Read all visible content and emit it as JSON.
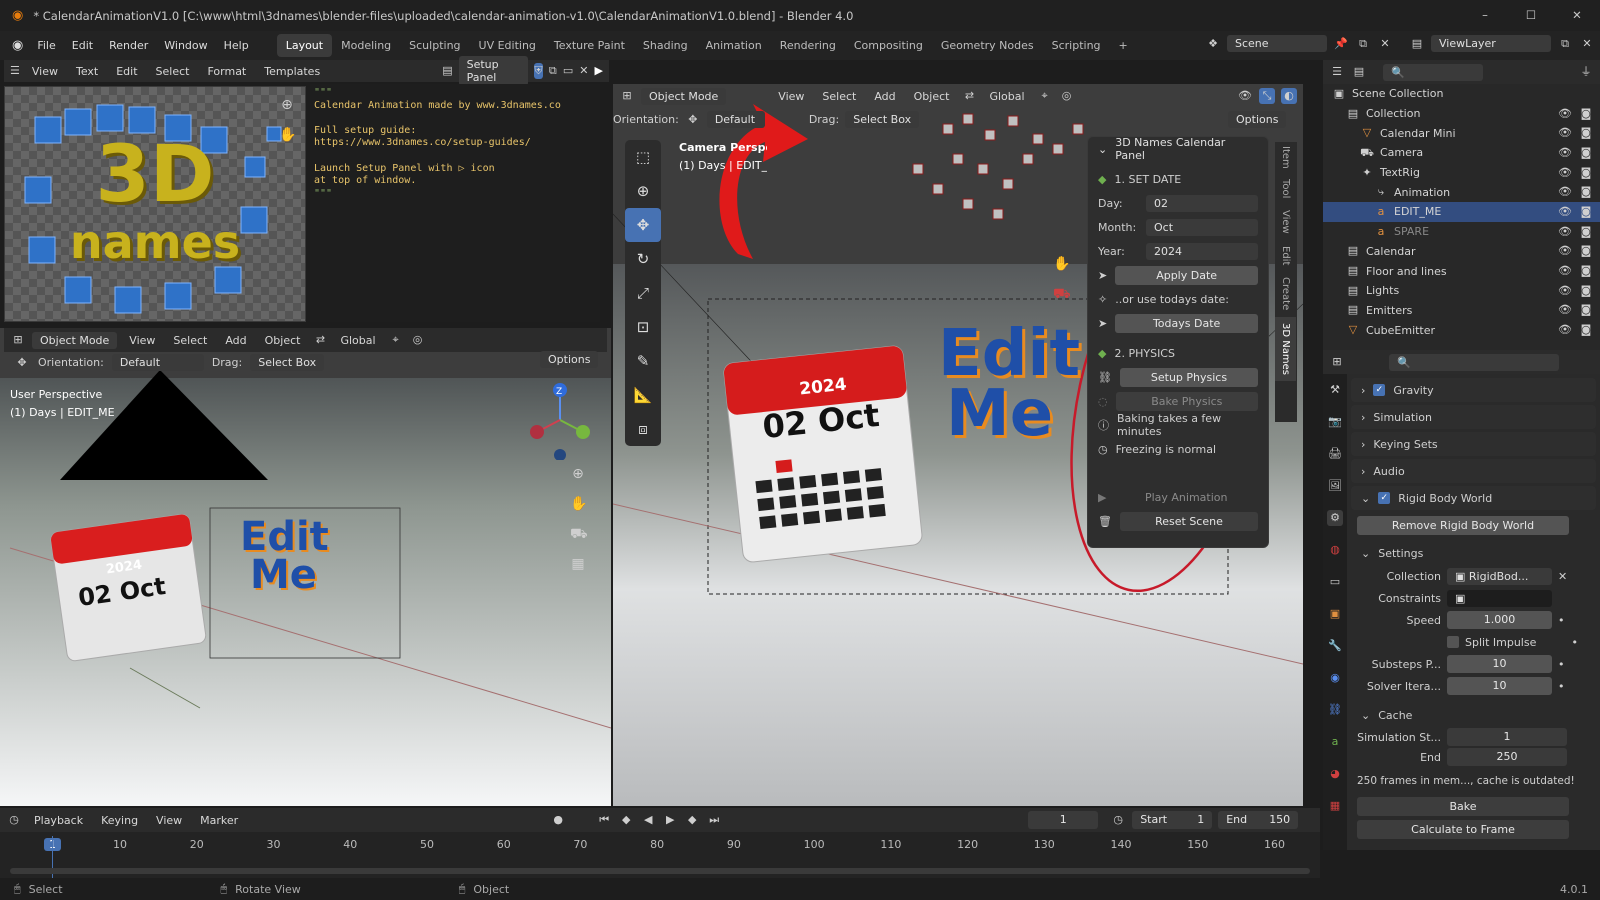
{
  "window": {
    "title": "* CalendarAnimationV1.0 [C:\\www\\html\\3dnames\\blender-files\\uploaded\\calendar-animation-v1.0\\CalendarAnimationV1.0.blend] - Blender 4.0",
    "min": "–",
    "max": "☐",
    "close": "✕"
  },
  "menu": [
    "File",
    "Edit",
    "Render",
    "Window",
    "Help"
  ],
  "workspaces": [
    "Layout",
    "Modeling",
    "Sculpting",
    "UV Editing",
    "Texture Paint",
    "Shading",
    "Animation",
    "Rendering",
    "Compositing",
    "Geometry Nodes",
    "Scripting"
  ],
  "workspace_add": "+",
  "scene": {
    "label": "Scene",
    "viewlayer": "ViewLayer"
  },
  "text_editor": {
    "menus": [
      "View",
      "Text",
      "Edit",
      "Select",
      "Format",
      "Templates"
    ],
    "file": "Setup Panel",
    "lines": [
      "\"\"\"",
      "Calendar Animation made by www.3dnames.co",
      "",
      "Full setup guide:",
      "https://www.3dnames.co/setup-guides/",
      "",
      "Launch Setup Panel with ▷ icon",
      "at top of window.",
      "\"\"\""
    ]
  },
  "logo": {
    "line1": "3D",
    "line2": "names"
  },
  "viewport_left": {
    "mode": "Object Mode",
    "menus": [
      "View",
      "Select",
      "Add",
      "Object"
    ],
    "transform": "Global",
    "orientation_label": "Orientation:",
    "orientation": "Default",
    "drag_label": "Drag:",
    "drag": "Select Box",
    "options": "Options",
    "persp": "User Perspective",
    "context": "(1) Days | EDIT_ME"
  },
  "viewport_main": {
    "mode": "Object Mode",
    "menus": [
      "View",
      "Select",
      "Add",
      "Object"
    ],
    "transform": "Global",
    "orientation_label": "Orientation:",
    "orientation": "Default",
    "drag_label": "Drag:",
    "drag": "Select Box",
    "options": "Options",
    "persp": "Camera Perspective",
    "context": "(1) Days | EDIT_ME",
    "side_tabs": [
      "Item",
      "Tool",
      "View",
      "Edit",
      "Create",
      "3D Names"
    ]
  },
  "calendar": {
    "year": "2024",
    "date": "02 Oct"
  },
  "edit_me": {
    "line1": "Edit",
    "line2": "Me"
  },
  "names_panel": {
    "title": "3D Names Calendar Panel",
    "section1": "1. SET DATE",
    "day_label": "Day:",
    "day": "02",
    "month_label": "Month:",
    "month": "Oct",
    "year_label": "Year:",
    "year": "2024",
    "apply": "Apply Date",
    "or_today": "..or use todays date:",
    "today": "Todays Date",
    "section2": "2. PHYSICS",
    "setup_physics": "Setup Physics",
    "bake_physics": "Bake Physics",
    "note1": "Baking takes a few minutes",
    "note2": "Freezing is normal",
    "play": "Play Animation",
    "reset": "Reset Scene"
  },
  "outliner": {
    "root": "Scene Collection",
    "items": [
      {
        "name": "Collection",
        "indent": 1,
        "icon": "collection-icon"
      },
      {
        "name": "Calendar Mini",
        "indent": 2,
        "icon": "mesh-icon"
      },
      {
        "name": "Camera",
        "indent": 2,
        "icon": "camera-icon"
      },
      {
        "name": "TextRig",
        "indent": 2,
        "icon": "armature-icon"
      },
      {
        "name": "Animation",
        "indent": 3,
        "icon": "action-icon"
      },
      {
        "name": "EDIT_ME",
        "indent": 3,
        "icon": "text-icon"
      },
      {
        "name": "SPARE",
        "indent": 3,
        "icon": "text-icon"
      },
      {
        "name": "Calendar",
        "indent": 1,
        "icon": "collection-icon"
      },
      {
        "name": "Floor and lines",
        "indent": 1,
        "icon": "collection-icon"
      },
      {
        "name": "Lights",
        "indent": 1,
        "icon": "collection-icon"
      },
      {
        "name": "Emitters",
        "indent": 1,
        "icon": "collection-icon"
      },
      {
        "name": "CubeEmitter",
        "indent": 1,
        "icon": "mesh-icon"
      }
    ]
  },
  "properties": {
    "gravity": "Gravity",
    "simulation": "Simulation",
    "keying_sets": "Keying Sets",
    "audio": "Audio",
    "rigid_body_world": "Rigid Body World",
    "remove_rbw": "Remove Rigid Body World",
    "settings": "Settings",
    "collection_label": "Collection",
    "collection_value": "RigidBod...",
    "constraints_label": "Constraints",
    "speed_label": "Speed",
    "speed": "1.000",
    "split_impulse": "Split Impulse",
    "substeps_label": "Substeps P...",
    "substeps": "10",
    "solver_label": "Solver Itera...",
    "solver": "10",
    "cache": "Cache",
    "sim_start_label": "Simulation St...",
    "sim_start": "1",
    "end_label": "End",
    "end": "250",
    "cache_info": "250 frames in mem..., cache is outdated!",
    "bake": "Bake",
    "calc_frame": "Calculate to Frame"
  },
  "timeline": {
    "menus": [
      "Playback",
      "Keying",
      "View",
      "Marker"
    ],
    "current": "1",
    "start_label": "Start",
    "start": "1",
    "end_label": "End",
    "end": "150",
    "ticks": [
      "1",
      "10",
      "20",
      "30",
      "40",
      "50",
      "60",
      "70",
      "80",
      "90",
      "100",
      "110",
      "120",
      "130",
      "140",
      "150",
      "160"
    ]
  },
  "statusbar": {
    "select": "Select",
    "rotate": "Rotate View",
    "object": "Object",
    "version": "4.0.1"
  }
}
